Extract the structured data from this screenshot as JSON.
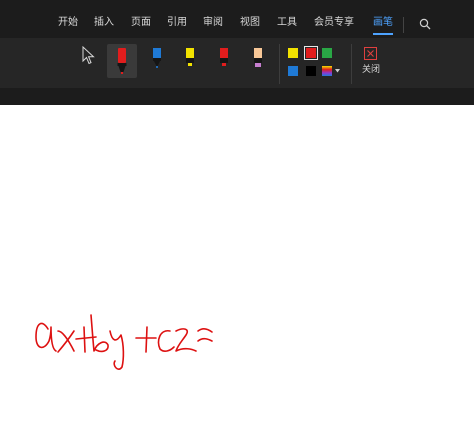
{
  "menu": {
    "tabs": [
      {
        "label": "开始"
      },
      {
        "label": "插入"
      },
      {
        "label": "页面"
      },
      {
        "label": "引用"
      },
      {
        "label": "审阅"
      },
      {
        "label": "视图"
      },
      {
        "label": "工具"
      },
      {
        "label": "会员专享"
      },
      {
        "label": "画笔"
      }
    ],
    "active_tab": "画笔",
    "search_icon": "search-icon"
  },
  "ribbon": {
    "tools": [
      {
        "name": "select-cursor",
        "icon": "cursor-icon"
      },
      {
        "name": "red-marker",
        "color": "#e11d1d",
        "selected": true
      },
      {
        "name": "blue-pen",
        "color": "#1f7ad6"
      },
      {
        "name": "yellow-highlighter",
        "color": "#f2e200"
      },
      {
        "name": "red-highlighter",
        "color": "#e11d1d"
      },
      {
        "name": "peach-highlighter",
        "color": "#f7c797"
      }
    ],
    "palette": [
      {
        "color": "#f2e200"
      },
      {
        "color": "#e11d1d",
        "selected": true
      },
      {
        "color": "#29a745"
      },
      {
        "color": "#1f7ad6"
      },
      {
        "color": "#000000"
      },
      {
        "color": "multicolor",
        "icon": "more-colors-icon"
      }
    ],
    "close_label": "关闭",
    "close_icon": "close-icon"
  },
  "canvas": {
    "ink_color": "#dd1111"
  }
}
